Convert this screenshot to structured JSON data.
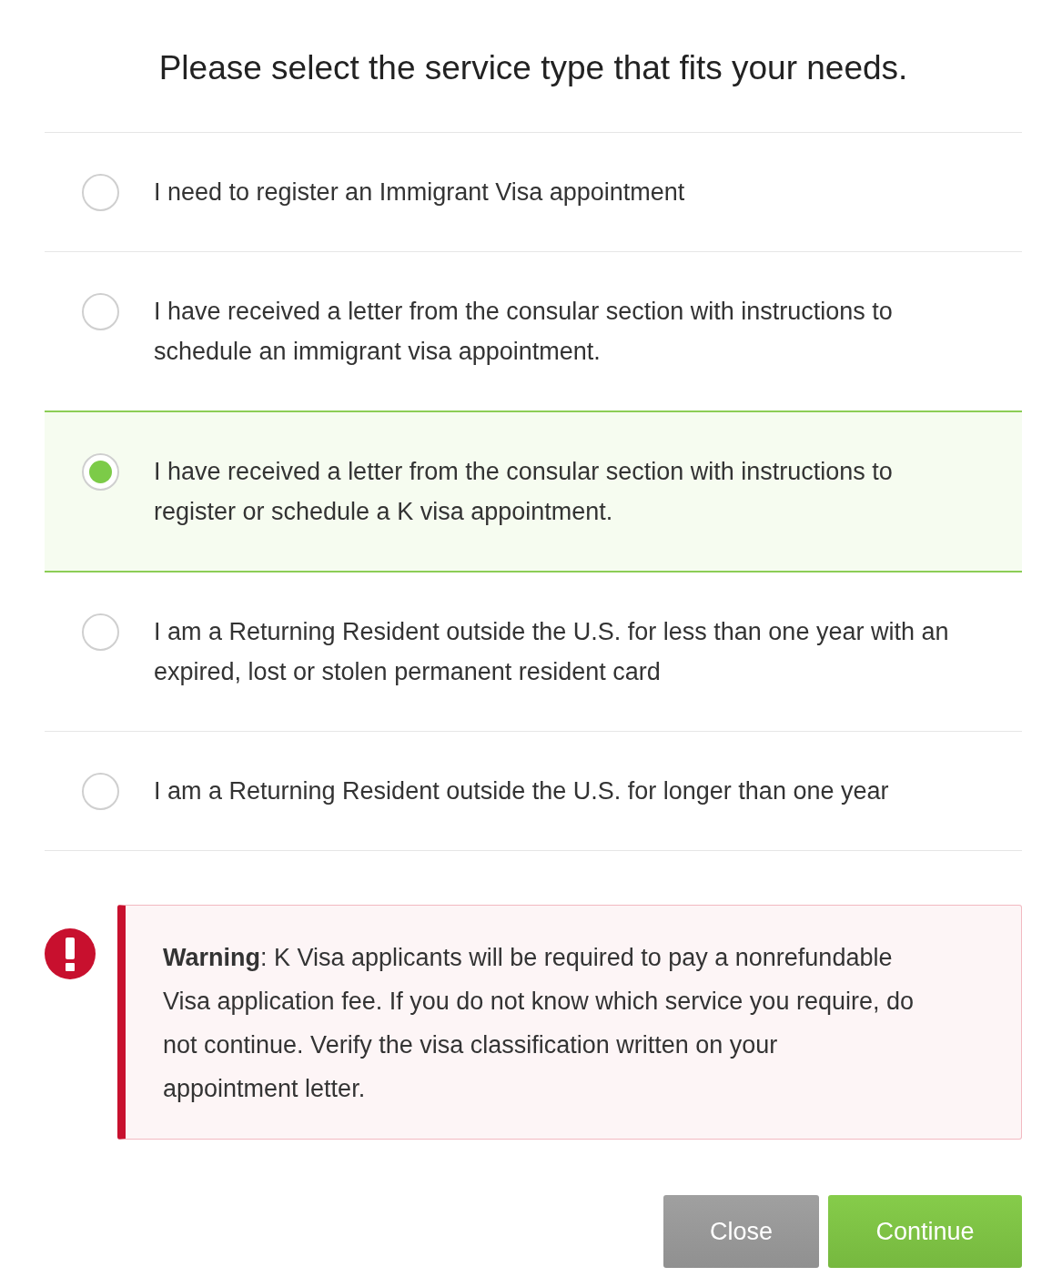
{
  "title": "Please select the service type that fits your needs.",
  "options": [
    {
      "label": "I need to register an Immigrant Visa appointment",
      "selected": false
    },
    {
      "label": "I have received a letter from the consular section with instructions to schedule an immigrant visa appointment.",
      "selected": false
    },
    {
      "label": "I have received a letter from the consular section with instructions to register or schedule a K visa appointment.",
      "selected": true
    },
    {
      "label": "I am a Returning Resident outside the U.S. for less than one year with an expired, lost or stolen permanent resident card",
      "selected": false
    },
    {
      "label": "I am a Returning Resident outside the U.S. for longer than one year",
      "selected": false
    }
  ],
  "warning": {
    "text": "**Warning**: K Visa applicants will be required to pay a nonrefundable Visa application fee. If you do not know which service you require, do not continue. Verify the visa classification written on your appointment letter."
  },
  "buttons": [
    {
      "label": "Close",
      "kind": "secondary"
    },
    {
      "label": "Continue",
      "kind": "primary"
    }
  ]
}
